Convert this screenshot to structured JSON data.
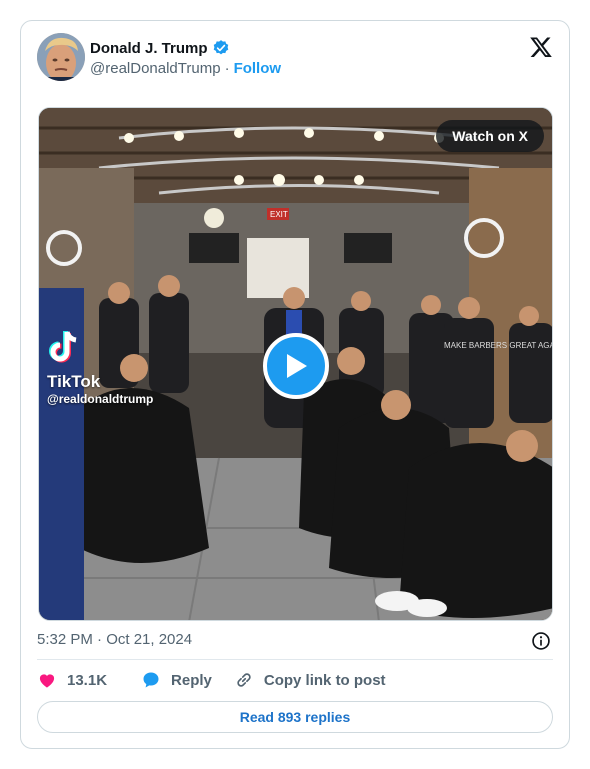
{
  "author": {
    "name": "Donald J. Trump",
    "handle": "@realDonaldTrump",
    "separator": "·",
    "follow_label": "Follow",
    "verified_color": "#1d9bf0"
  },
  "media": {
    "watch_label": "Watch on X",
    "overlay_brand": "TikTok",
    "overlay_handle": "@realdonaldtrump",
    "exit_sign": "EXIT",
    "shirt_text": "MAKE BARBERS GREAT AGAIN"
  },
  "post": {
    "timestamp": "5:32 PM · Oct 21, 2024"
  },
  "actions": {
    "likes": "13.1K",
    "reply_label": "Reply",
    "copy_label": "Copy link to post"
  },
  "footer": {
    "read_replies": "Read 893 replies"
  },
  "colors": {
    "accent": "#1d9bf0",
    "heart": "#f91880",
    "border": "#cfd9de",
    "muted": "#536471"
  },
  "icons": [
    "verified-badge-icon",
    "x-logo-icon",
    "play-icon",
    "info-icon",
    "heart-icon",
    "reply-bubble-icon",
    "link-icon"
  ]
}
